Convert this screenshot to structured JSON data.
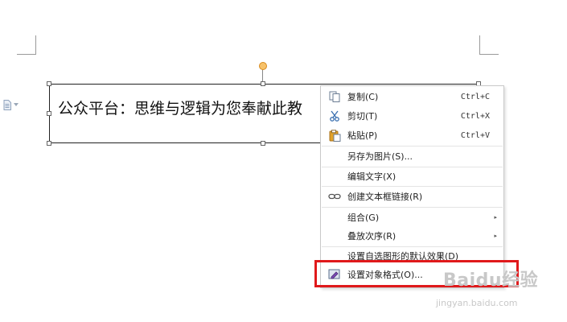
{
  "document": {
    "text_box_content": "公众平台：思维与逻辑为您奉献此教"
  },
  "context_menu": {
    "items": [
      {
        "label": "复制(C)",
        "shortcut": "Ctrl+C",
        "icon": "copy-icon"
      },
      {
        "label": "剪切(T)",
        "shortcut": "Ctrl+X",
        "icon": "scissors-icon"
      },
      {
        "label": "粘贴(P)",
        "shortcut": "Ctrl+V",
        "icon": "paste-icon"
      },
      {
        "label": "另存为图片(S)...",
        "shortcut": ""
      },
      {
        "label": "编辑文字(X)",
        "shortcut": ""
      },
      {
        "label": "创建文本框链接(R)",
        "shortcut": "",
        "icon": "link-icon"
      },
      {
        "label": "组合(G)",
        "shortcut": "",
        "submenu": true
      },
      {
        "label": "叠放次序(R)",
        "shortcut": "",
        "submenu": true
      },
      {
        "label": "设置自选图形的默认效果(D)",
        "shortcut": ""
      },
      {
        "label": "设置对象格式(O)...",
        "shortcut": "",
        "icon": "format-object-icon",
        "highlighted": true
      }
    ],
    "submenu_glyph": "▸"
  },
  "watermark": {
    "logo": "Baidu经验",
    "site": "jingyan.baidu.com"
  },
  "colors": {
    "highlight_border": "#e0191b",
    "rotation_handle": "#f7c26a"
  }
}
